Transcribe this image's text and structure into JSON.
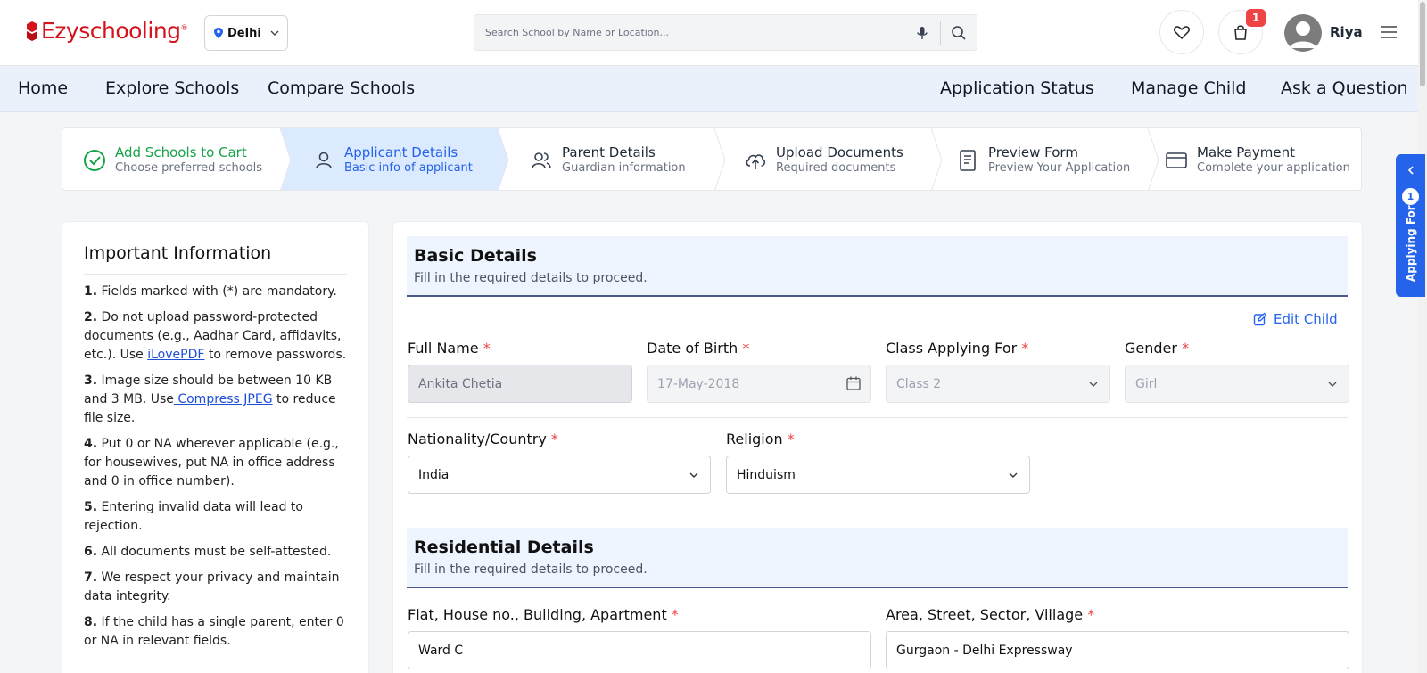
{
  "brand": {
    "part1": "Ezy",
    "part2": "schooling",
    "reg": "®"
  },
  "location": {
    "city": "Delhi"
  },
  "search": {
    "placeholder": "Search School by Name or Location..."
  },
  "cart": {
    "count": "1"
  },
  "user": {
    "name": "Riya"
  },
  "nav": {
    "left": [
      "Home",
      "Explore Schools",
      "Compare Schools"
    ],
    "right": [
      "Application Status",
      "Manage Child",
      "Ask a Question"
    ]
  },
  "steps": [
    {
      "title": "Add Schools to Cart",
      "sub": "Choose preferred schools",
      "state": "done",
      "icon": "check-circle-icon"
    },
    {
      "title": "Applicant Details",
      "sub": "Basic info of applicant",
      "state": "active",
      "icon": "user-icon"
    },
    {
      "title": "Parent Details",
      "sub": "Guardian information",
      "state": "pending",
      "icon": "users-icon"
    },
    {
      "title": "Upload Documents",
      "sub": "Required documents",
      "state": "pending",
      "icon": "cloud-upload-icon"
    },
    {
      "title": "Preview Form",
      "sub": "Preview Your Application",
      "state": "pending",
      "icon": "document-icon"
    },
    {
      "title": "Make Payment",
      "sub": "Complete your application",
      "state": "pending",
      "icon": "credit-card-icon"
    }
  ],
  "info": {
    "title": "Important Information",
    "items": [
      {
        "num": "1.",
        "text": "Fields marked with (*) are mandatory."
      },
      {
        "num": "2.",
        "before": "Do not upload password-protected documents (e.g., Aadhar Card, affidavits, etc.). Use ",
        "link": "iLovePDF",
        "after": " to remove passwords."
      },
      {
        "num": "3.",
        "before": "Image size should be between 10 KB and 3 MB. Use",
        "link": " Compress JPEG",
        "after": " to reduce file size."
      },
      {
        "num": "4.",
        "text": "Put 0 or NA wherever applicable (e.g., for housewives, put NA in office address and 0 in office number)."
      },
      {
        "num": "5.",
        "text": "Entering invalid data will lead to rejection."
      },
      {
        "num": "6.",
        "text": "All documents must be self-attested."
      },
      {
        "num": "7.",
        "text": "We respect your privacy and maintain data integrity."
      },
      {
        "num": "8.",
        "text": "If the child has a single parent, enter 0 or NA in relevant fields."
      }
    ]
  },
  "basic": {
    "title": "Basic Details",
    "subtitle": "Fill in the required details to proceed.",
    "edit_label": "Edit Child",
    "full_name_label": "Full Name",
    "full_name": "Ankita Chetia",
    "dob_label": "Date of Birth",
    "dob": "17-May-2018",
    "class_label": "Class Applying For",
    "class": "Class 2",
    "gender_label": "Gender",
    "gender": "Girl",
    "nationality_label": "Nationality/Country",
    "nationality": "India",
    "religion_label": "Religion",
    "religion": "Hinduism",
    "required_mark": "*"
  },
  "residential": {
    "title": "Residential Details",
    "subtitle": "Fill in the required details to proceed.",
    "flat_label": "Flat, House no., Building, Apartment",
    "flat": "Ward C",
    "area_label": "Area, Street, Sector, Village",
    "area": "Gurgaon - Delhi Expressway"
  },
  "applying_for": {
    "label": "Applying For",
    "count": "1"
  },
  "colors": {
    "brand": "#d5121b",
    "primary": "#2563eb",
    "success": "#16a34a",
    "required": "#ef4444"
  }
}
